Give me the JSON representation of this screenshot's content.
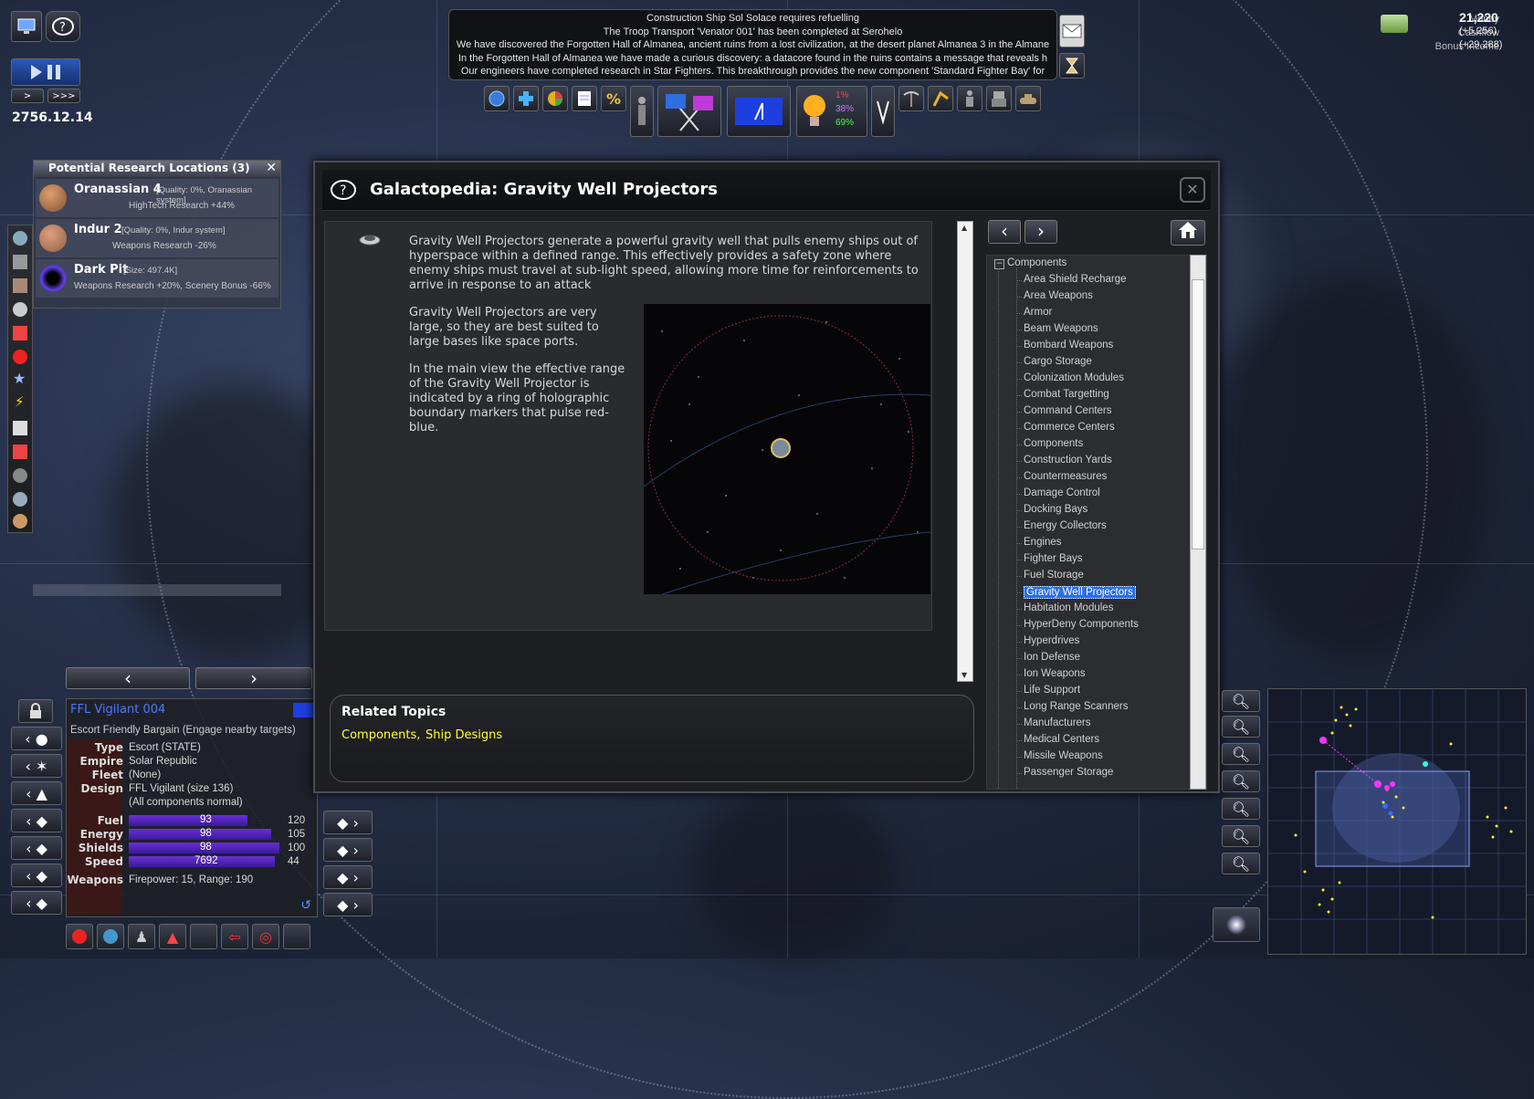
{
  "game": {
    "date": "2756.12.14",
    "speed_buttons": [
      ">",
      ">>>"
    ]
  },
  "finance": {
    "money_label": "Money",
    "money_value": "21,220",
    "cashflow_label": "Cashflow",
    "cashflow_value": "(+5,256)",
    "bonus_label": "Bonus Income",
    "bonus_value": "(+29,288)"
  },
  "messages": [
    "Construction Ship Sol Solace requires refuelling",
    "The Troop Transport 'Venator 001' has been completed at Serohelo",
    "We have discovered the Forgotten Hall of Almanea, ancient ruins from a lost civilization, at the desert planet Almanea 3 in the Almane",
    "In the Forgotten Hall of Almanea we have made a curious discovery: a datacore found in the ruins contains a message that reveals h",
    "Our engineers have completed research in Star Fighters. This breakthrough provides the new component 'Standard Fighter Bay' for"
  ],
  "toolbar": {
    "research_stats": [
      "1%",
      "38%",
      "69%"
    ]
  },
  "research_locations": {
    "title": "Potential Research Locations (3)",
    "items": [
      {
        "name": "Oranassian 4",
        "meta": "[Quality: 0%, Oranassian system]",
        "detail": "HighTech Research +44%"
      },
      {
        "name": "Indur 2",
        "meta": "[Quality: 0%, Indur system]",
        "detail": "Weapons Research -26%"
      },
      {
        "name": "Dark Pit",
        "meta": "[Size: 497.4K]",
        "detail": "Weapons Research +20%, Scenery Bonus -66%"
      }
    ]
  },
  "galactopedia": {
    "title": "Galactopedia: Gravity Well Projectors",
    "para1": "Gravity Well Projectors generate a powerful gravity well that pulls enemy ships out of hyperspace within a defined range. This effectively provides a safety zone where enemy ships must travel at sub-light speed, allowing more time for reinforcements to arrive in response to an attack",
    "para2": "Gravity Well Projectors are very large, so they are best suited to large bases like space ports.",
    "para3": "In the main view the effective range of the Gravity Well Projector is indicated by a ring of holographic boundary markers that pulse red-blue.",
    "related_title": "Related Topics",
    "related_links": [
      "Components,",
      "Ship Designs"
    ],
    "tree_root": "Components",
    "tree_items": [
      "Area Shield Recharge",
      "Area Weapons",
      "Armor",
      "Beam Weapons",
      "Bombard Weapons",
      "Cargo Storage",
      "Colonization Modules",
      "Combat Targetting",
      "Command Centers",
      "Commerce Centers",
      "Components",
      "Construction Yards",
      "Countermeasures",
      "Damage Control",
      "Docking Bays",
      "Energy Collectors",
      "Engines",
      "Fighter Bays",
      "Fuel Storage",
      "Gravity Well Projectors",
      "Habitation Modules",
      "HyperDeny Components",
      "Hyperdrives",
      "Ion Defense",
      "Ion Weapons",
      "Life Support",
      "Long Range Scanners",
      "Manufacturers",
      "Medical Centers",
      "Missile Weapons",
      "Passenger Storage"
    ],
    "selected_item": "Gravity Well Projectors"
  },
  "ship": {
    "name": "FFL Vigilant 004",
    "mission": "Escort Friendly Bargain (Engage nearby targets)",
    "type_label": "Type",
    "type_value": "Escort (STATE)",
    "empire_label": "Empire",
    "empire_value": "Solar Republic",
    "fleet_label": "Fleet",
    "fleet_value": "(None)",
    "design_label": "Design",
    "design_value": "FFL Vigilant (size 136)",
    "design_note": "(All components normal)",
    "fuel_label": "Fuel",
    "fuel_value": "93",
    "fuel_max": "120",
    "fuel_frac": 0.775,
    "energy_label": "Energy",
    "energy_value": "98",
    "energy_max": "105",
    "energy_frac": 0.93,
    "shields_label": "Shields",
    "shields_value": "98",
    "shields_max": "100",
    "shields_frac": 0.98,
    "speed_label": "Speed",
    "speed_value": "7692",
    "speed_max": "44",
    "speed_frac": 0.95,
    "weapons_label": "Weapons",
    "weapons_value": "Firepower: 15, Range: 190"
  },
  "colors": {
    "accent": "#2a6ee8",
    "link": "#ffff3a",
    "bar": "#5a2ad0",
    "magenta": "#ff33ff"
  }
}
